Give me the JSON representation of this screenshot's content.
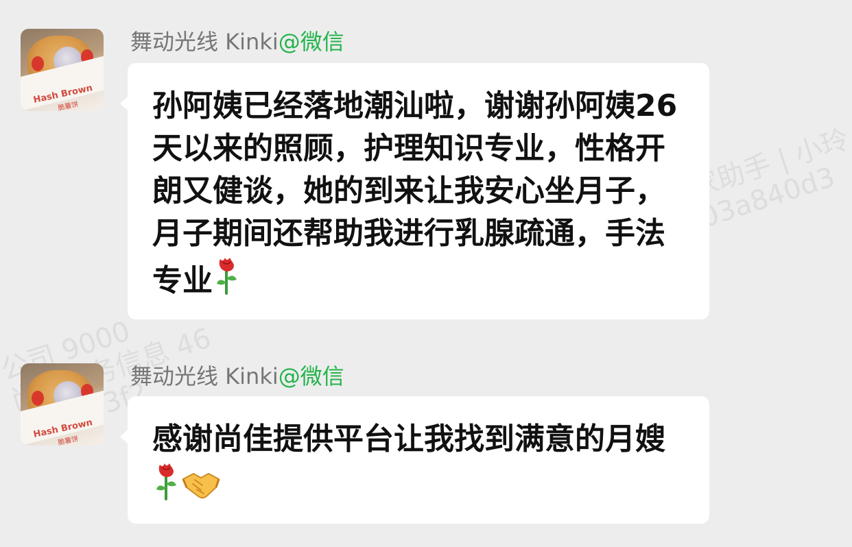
{
  "watermarks": {
    "right": "家助手 | 小玲\n03a840d3",
    "left": "公司 9000\n尚佳服务信息 46\na8b343f2"
  },
  "messages": [
    {
      "sender": "舞动光线 Kinki",
      "app_tag": "@微信",
      "text": "孙阿姨已经落地潮汕啦，谢谢孙阿姨26天以来的照顾，护理知识专业，性格开朗又健谈，她的到来让我安心坐月子，月子期间还帮助我进行乳腺疏通，手法专业",
      "emojis": [
        "rose-emoji"
      ],
      "avatar_label": "Hash Brown",
      "avatar_sublabel": "脆薯饼"
    },
    {
      "sender": "舞动光线 Kinki",
      "app_tag": "@微信",
      "text": "感谢尚佳提供平台让我找到满意的月嫂",
      "emojis": [
        "rose-emoji",
        "handshake-emoji"
      ],
      "avatar_label": "Hash Brown",
      "avatar_sublabel": "脆薯饼"
    }
  ],
  "colors": {
    "background": "#ededed",
    "bubble": "#ffffff",
    "app_tag": "#23b44a",
    "sender": "#767676"
  }
}
